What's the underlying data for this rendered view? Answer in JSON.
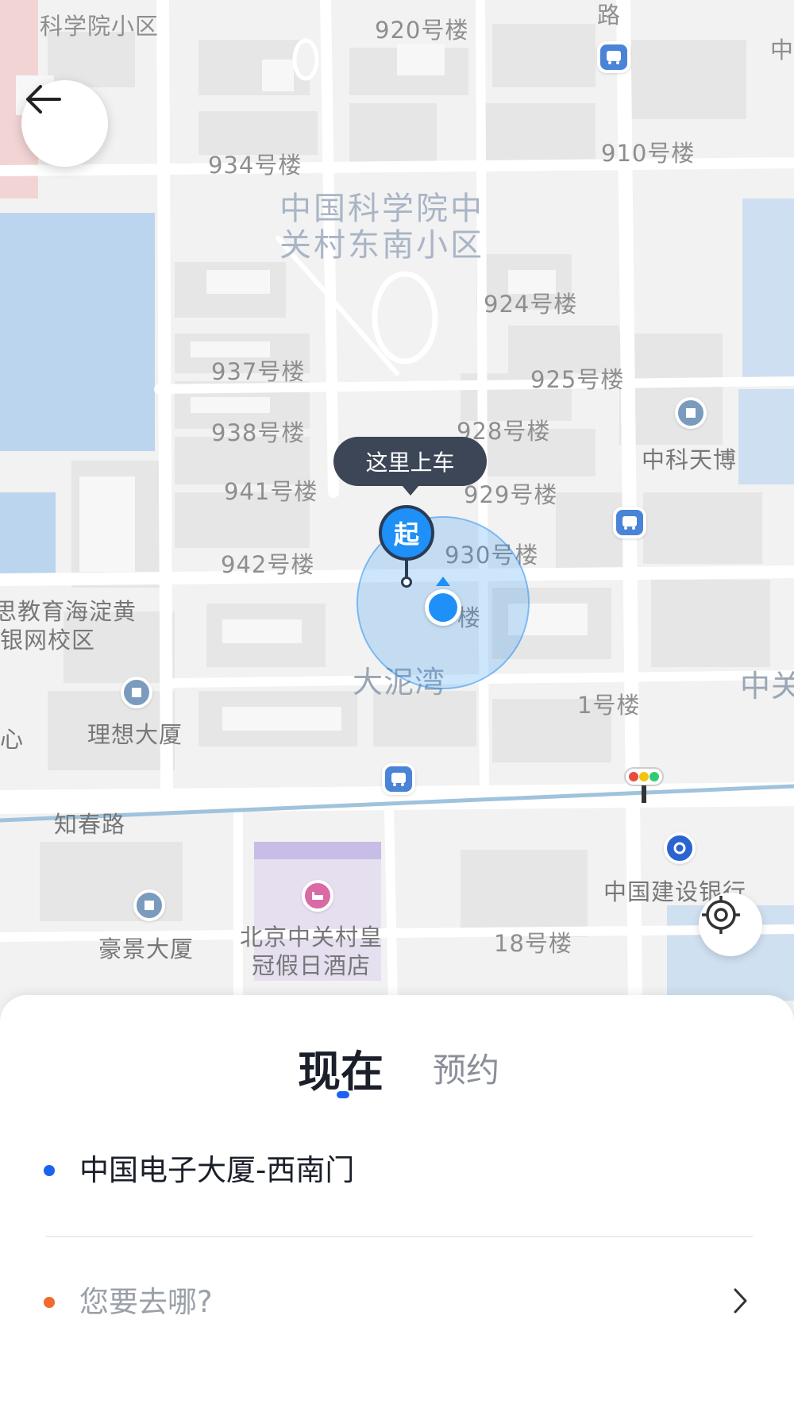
{
  "map": {
    "labels": [
      "科学院小区",
      "920号楼",
      "路",
      "中",
      "934号楼",
      "910号楼",
      "924号楼",
      "937号楼",
      "925号楼",
      "938号楼",
      "928号楼",
      "中科天博",
      "941号楼",
      "929号楼",
      "942号楼",
      "930号楼",
      "思教育海淀黄",
      "银网校区",
      "楼",
      "1号楼",
      "中关",
      "心",
      "理想大厦",
      "知春路",
      "中国建设银行",
      "豪景大厦",
      "18号楼"
    ],
    "area_labels": {
      "community": [
        "中国科学院中",
        "关村东南小区"
      ],
      "dani_wan": "大泥湾",
      "hotel": [
        "北京中关村皇",
        "冠假日酒店"
      ]
    },
    "pickup_tooltip": "这里上车",
    "start_marker": "起"
  },
  "order_panel": {
    "tabs": [
      {
        "label": "现在",
        "active": true
      },
      {
        "label": "预约",
        "active": false
      }
    ],
    "pickup": {
      "text": "中国电子大厦-西南门",
      "dot_color": "#1c62f0"
    },
    "destination": {
      "placeholder": "您要去哪?",
      "dot_color": "#f26a2e"
    }
  },
  "colors": {
    "accent": "#1c62f0",
    "marker_blue": "#1e90f7",
    "tooltip_bg": "#3c4656",
    "water": "#bdd6ee"
  }
}
